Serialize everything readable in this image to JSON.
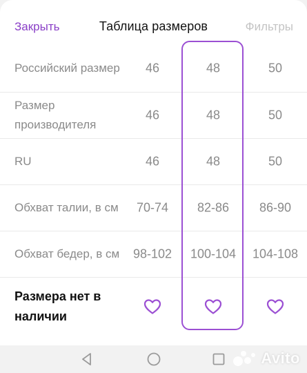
{
  "header": {
    "close_label": "Закрыть",
    "title": "Таблица размеров",
    "filters_label": "Фильтры"
  },
  "table": {
    "rows": [
      {
        "label": "Российский размер",
        "values": [
          "46",
          "48",
          "50"
        ]
      },
      {
        "label": "Размер производителя",
        "values": [
          "46",
          "48",
          "50"
        ]
      },
      {
        "label": "RU",
        "values": [
          "46",
          "48",
          "50"
        ]
      },
      {
        "label": "Обхват талии, в см",
        "values": [
          "70-74",
          "82-86",
          "86-90"
        ]
      },
      {
        "label": "Обхват бедер, в см",
        "values": [
          "98-102",
          "100-104",
          "104-108"
        ]
      }
    ],
    "out_of_stock_label": "Размера нет в наличии",
    "selected_column": 1
  },
  "icons": {
    "heart": "heart-outline-icon",
    "back": "triangle-back-icon",
    "home": "circle-home-icon",
    "recent": "square-recent-icon"
  },
  "colors": {
    "accent": "#9b4fd3",
    "close_text": "#8a3fc7",
    "muted_text": "#8a8a8a",
    "disabled_text": "#c4c4c4"
  },
  "watermark": {
    "text": "Avito"
  }
}
